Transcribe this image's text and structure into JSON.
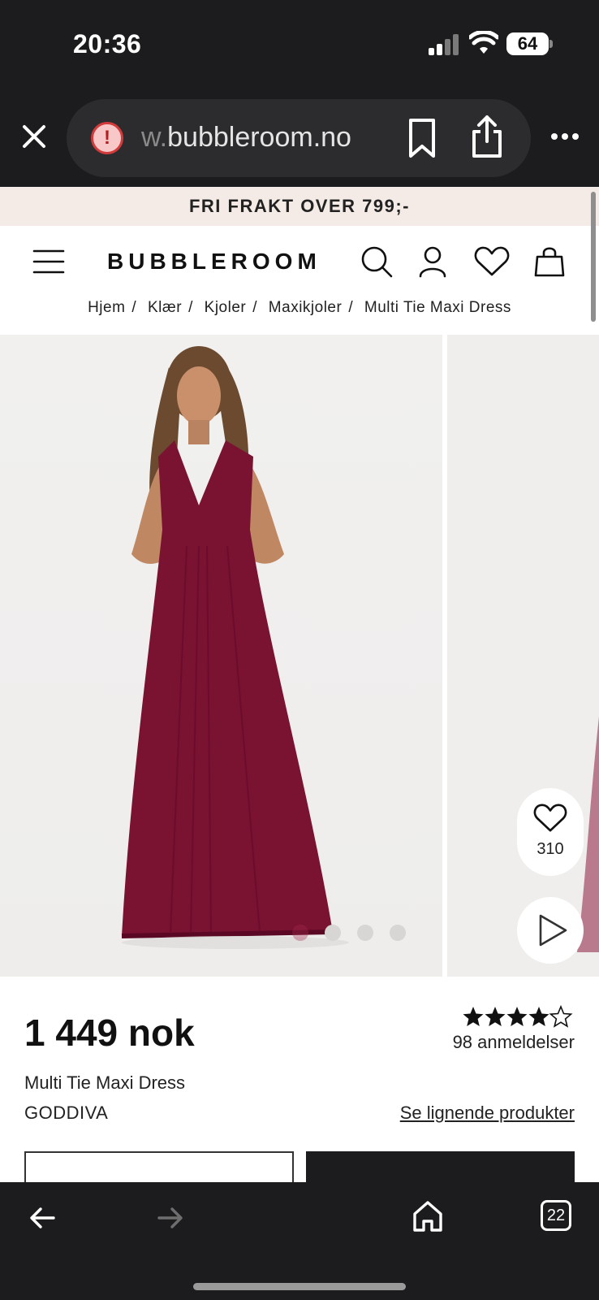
{
  "status_bar": {
    "time": "20:36",
    "battery": "64"
  },
  "browser": {
    "url_faded": "w.",
    "url_main": "bubbleroom.no",
    "tab_count": "22",
    "icons": [
      "close-icon",
      "warning-icon",
      "bookmark-icon",
      "share-icon",
      "more-icon",
      "back-icon",
      "forward-icon",
      "home-icon",
      "tabs-icon"
    ]
  },
  "site": {
    "promo": "FRI FRAKT OVER 799;-",
    "logo": "BUBBLEROOM",
    "breadcrumb": [
      "Hjem",
      "Klær",
      "Kjoler",
      "Maxikjoler",
      "Multi Tie Maxi Dress"
    ],
    "separator": "/"
  },
  "product": {
    "price": "1 449 nok",
    "rating": 4.5,
    "reviews": "98 anmeldelser",
    "name": "Multi Tie Maxi Dress",
    "brand": "GODDIVA",
    "similar_link": "Se lignende produkter",
    "favorites": "310",
    "image_count": 4,
    "active_image": 0,
    "dress_color": "#7a1232"
  }
}
